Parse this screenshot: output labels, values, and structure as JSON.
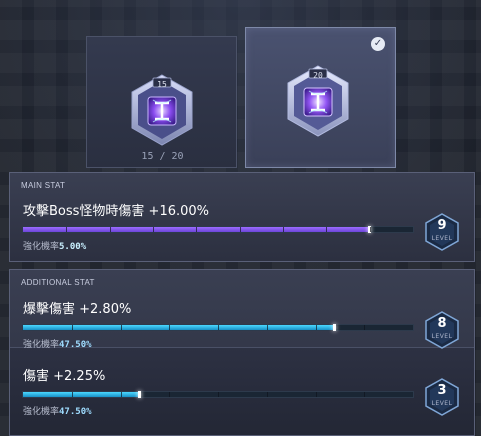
{
  "cards": [
    {
      "level": "15",
      "progress": "15 / 20",
      "selected": false
    },
    {
      "level": "20",
      "progress": "",
      "selected": true
    }
  ],
  "main_stat": {
    "section_label": "MAIN STAT",
    "name": "攻擊Boss怪物時傷害 +16.00%",
    "fill": 0.89,
    "chance_label": "強化機率",
    "chance_value": "5.00%",
    "level": "9",
    "level_word": "LEVEL"
  },
  "additional_stat": {
    "section_label": "ADDITIONAL STAT",
    "items": [
      {
        "name": "爆擊傷害 +2.80%",
        "fill": 0.8,
        "chance_label": "強化機率",
        "chance_value": "47.50%",
        "level": "8",
        "level_word": "LEVEL"
      },
      {
        "name": "傷害 +2.25%",
        "fill": 0.3,
        "chance_label": "強化機率",
        "chance_value": "47.50%",
        "level": "3",
        "level_word": "LEVEL"
      }
    ]
  },
  "colors": {
    "main_bar": "#8a5cf0",
    "additional_bar": "#2fb6e8",
    "chance_value": "#9fdcff"
  },
  "icons": {
    "core_gem": "purple-core-gem-icon",
    "check": "check-icon",
    "level_badge": "hexagon-level-badge-icon"
  }
}
